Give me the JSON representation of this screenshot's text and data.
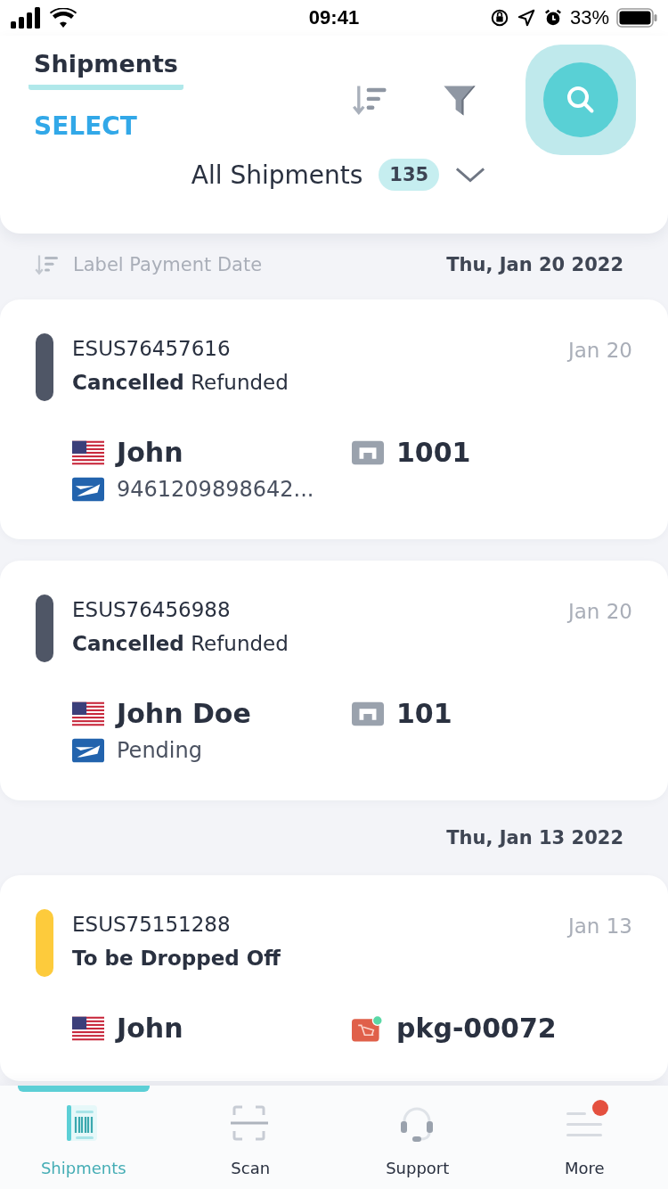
{
  "status_bar": {
    "time": "09:41",
    "battery": "33%"
  },
  "header": {
    "tab": {
      "label": "Shipments",
      "selected": true
    },
    "select": "SELECT",
    "filter": {
      "label": "All Shipments",
      "count": "135"
    }
  },
  "sort": {
    "label": "Label Payment Date"
  },
  "groups": [
    {
      "date": "Thu, Jan 20 2022",
      "shipments": [
        {
          "id": "ESUS76457616",
          "status": "Cancelled",
          "substatus": "Refunded",
          "date": "Jan 20",
          "color": "#4f5666",
          "recipient": "John",
          "kind": "store",
          "order": "1001",
          "tracking": "9461209898642..."
        },
        {
          "id": "ESUS76456988",
          "status": "Cancelled",
          "substatus": "Refunded",
          "date": "Jan 20",
          "color": "#4f5666",
          "recipient": "John Doe",
          "kind": "store",
          "order": "101",
          "tracking": "Pending"
        }
      ]
    },
    {
      "date": "Thu, Jan 13 2022",
      "shipments": [
        {
          "id": "ESUS75151288",
          "status": "To be Dropped Off",
          "date": "Jan 13",
          "color": "#fdcb3c",
          "recipient": "John",
          "kind": "package",
          "order": "pkg-00072"
        }
      ]
    }
  ],
  "tabs": [
    {
      "kind": "shipments",
      "label": "Shipments",
      "selected": true,
      "notification": false
    },
    {
      "kind": "scan",
      "label": "Scan",
      "selected": false,
      "notification": false
    },
    {
      "kind": "support",
      "label": "Support",
      "selected": false,
      "notification": false
    },
    {
      "kind": "more",
      "label": "More",
      "selected": false,
      "notification": true
    }
  ]
}
